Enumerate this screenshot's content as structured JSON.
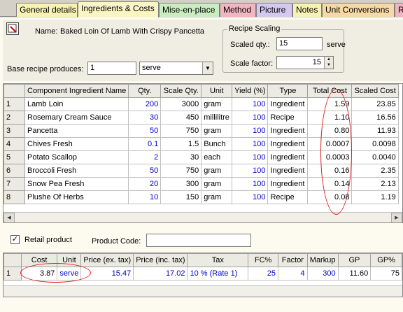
{
  "tabs": [
    {
      "label": "General details",
      "bg": "#f7f2b3"
    },
    {
      "label": "Ingredients & Costs",
      "bg": "#fbf5c4"
    },
    {
      "label": "Mise-en-place",
      "bg": "#c9edc0"
    },
    {
      "label": "Method",
      "bg": "#f2b6c0"
    },
    {
      "label": "Picture",
      "bg": "#d3c9f0"
    },
    {
      "label": "Notes",
      "bg": "#f7f2b3"
    },
    {
      "label": "Unit Conversions",
      "bg": "#f6d9a6"
    },
    {
      "label": "R",
      "bg": "#f2b6c0"
    }
  ],
  "recipe": {
    "name_label": "Name:",
    "name_value": "Baked Loin Of Lamb With Crispy Pancetta",
    "base_label": "Base recipe produces:",
    "base_qty": "1",
    "base_unit": "serve"
  },
  "scaling": {
    "title": "Recipe Scaling",
    "scaled_qty_label": "Scaled qty.:",
    "scaled_qty_value": "15",
    "scaled_qty_unit": "serve",
    "scale_factor_label": "Scale factor:",
    "scale_factor_value": "15"
  },
  "ingredients": {
    "headers": [
      "",
      "Component Ingredient Name",
      "Qty.",
      "Scale Qty.",
      "Unit",
      "Yield (%)",
      "Type",
      "Total Cost",
      "Scaled Cost"
    ],
    "rows": [
      [
        "1",
        "Lamb Loin",
        "200",
        "3000",
        "gram",
        "100",
        "Ingredient",
        "1.59",
        "23.85"
      ],
      [
        "2",
        "Rosemary Cream Sauce",
        "30",
        "450",
        "millilitre",
        "100",
        "Recipe",
        "1.10",
        "16.56"
      ],
      [
        "3",
        "Pancetta",
        "50",
        "750",
        "gram",
        "100",
        "Ingredient",
        "0.80",
        "11.93"
      ],
      [
        "4",
        "Chives Fresh",
        "0.1",
        "1.5",
        "Bunch",
        "100",
        "Ingredient",
        "0.0007",
        "0.0098"
      ],
      [
        "5",
        "Potato Scallop",
        "2",
        "30",
        "each",
        "100",
        "Ingredient",
        "0.0003",
        "0.0040"
      ],
      [
        "6",
        "Broccoli Fresh",
        "50",
        "750",
        "gram",
        "100",
        "Ingredient",
        "0.16",
        "2.35"
      ],
      [
        "7",
        "Snow Pea Fresh",
        "20",
        "300",
        "gram",
        "100",
        "Ingredient",
        "0.14",
        "2.13"
      ],
      [
        "8",
        "Plushe Of Herbs",
        "10",
        "150",
        "gram",
        "100",
        "Recipe",
        "0.08",
        "1.19"
      ]
    ]
  },
  "retail": {
    "checkbox_label": "Retail product",
    "checked_mark": "✓",
    "product_code_label": "Product Code:",
    "product_code_value": "",
    "headers": [
      "",
      "Cost",
      "Unit",
      "Price (ex. tax)",
      "Price (inc. tax)",
      "Tax",
      "FC%",
      "Factor",
      "Markup",
      "GP",
      "GP%"
    ],
    "row": [
      "1",
      "3.87",
      "serve",
      "15.47",
      "17.02",
      "10 % (Rate 1)",
      "25",
      "4",
      "300",
      "11.60",
      "75"
    ]
  },
  "colors": {
    "highlight_ellipse": "#e02020",
    "value_blue": "#0000cc"
  }
}
